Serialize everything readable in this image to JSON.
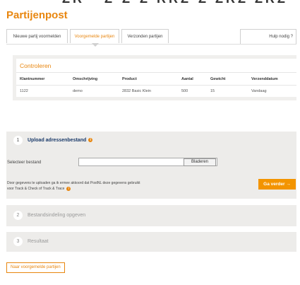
{
  "page": {
    "title": "Partijenpost"
  },
  "tabs": [
    {
      "label": "Nieuwe partij voormelden"
    },
    {
      "label": "Voorgemelde partijen"
    },
    {
      "label": "Verzonden partijen"
    }
  ],
  "help": {
    "label": "Hulp nodig ?"
  },
  "controleren": {
    "title": "Controleren",
    "headers": [
      "Klantnummer",
      "Omschrijving",
      "Product",
      "Aantal",
      "Gewicht",
      "Verzenddatum"
    ],
    "row": [
      "1122",
      "demo",
      "2832 Basic Klein",
      "500",
      "15",
      "Vandaag"
    ]
  },
  "steps": [
    {
      "num": "1",
      "title": "Upload adressenbestand"
    },
    {
      "num": "2",
      "title": "Bestandsindeling opgeven"
    },
    {
      "num": "3",
      "title": "Resultaat"
    }
  ],
  "upload": {
    "file_label": "Selecteer bestand",
    "browse_label": "Bladeren",
    "notice_line1": "Door gegevens te uploaden ga ik ermee akkoord dat PostNL deze gegevens gebruikt",
    "notice_line2": "voor Track & Check of Track & Trace",
    "continue_label": "Ga verder",
    "continue_arrow": "→"
  },
  "back_link": {
    "label": "Naar voorgemelde partijen"
  },
  "colors": {
    "accent": "#e8860f",
    "button": "#f39400",
    "step_bg": "#edecea",
    "step_title": "#1a3a6a"
  }
}
